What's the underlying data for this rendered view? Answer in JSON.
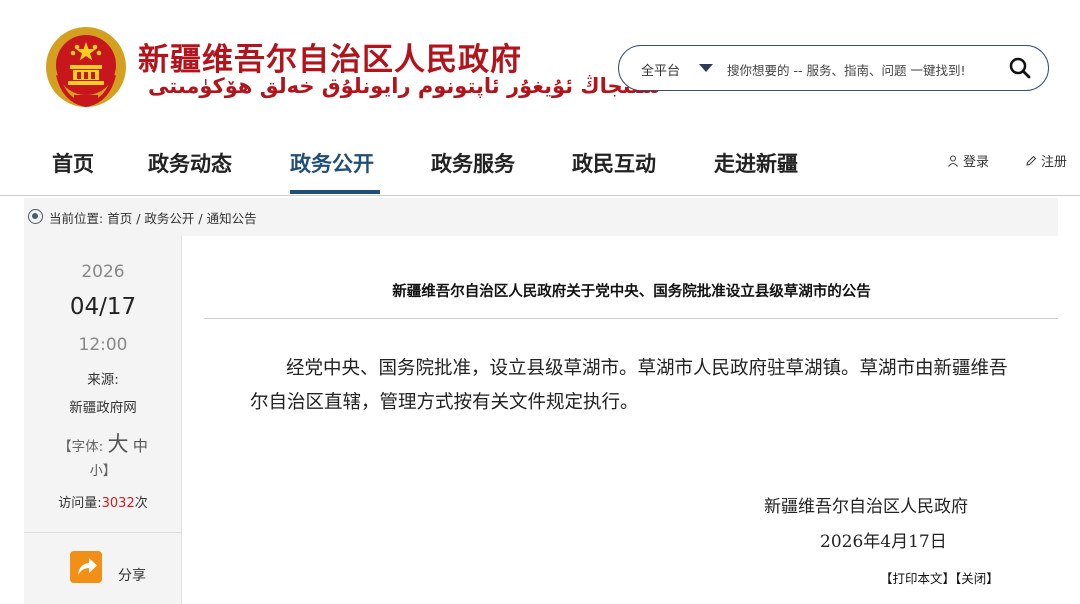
{
  "header": {
    "title": "新疆维吾尔自治区人民政府",
    "subtitle": "شىنجاڭ ئۇيغۇر ئاپتونوم رايونلۇق خەلق ھۆكۈمىتى",
    "colors": {
      "brand_red": "#b3141b",
      "nav_blue": "#1f4e79"
    }
  },
  "search": {
    "scope": "全平台",
    "placeholder": "搜你想要的 -- 服务、指南、问题  一键找到!",
    "icon": "search-icon"
  },
  "nav": {
    "items": [
      {
        "label": "首页"
      },
      {
        "label": "政务动态"
      },
      {
        "label": "政务公开",
        "active": true
      },
      {
        "label": "政务服务"
      },
      {
        "label": "政民互动"
      },
      {
        "label": "走进新疆"
      }
    ],
    "login": "登录",
    "register": "注册"
  },
  "breadcrumb": {
    "label": "当前位置:",
    "items": [
      "首页",
      "政务公开",
      "通知公告"
    ],
    "separator": " / "
  },
  "sidebar": {
    "year": "2026",
    "date": "04/17",
    "time": "12:00",
    "source_label": "来源:",
    "source": "新疆政府网",
    "font_label": "【字体:",
    "font_large": "大",
    "font_medium": "中",
    "font_small": "小",
    "font_close": "】",
    "visits_label": "访问量:",
    "visits": "3032",
    "visits_unit": "次",
    "share": "分享"
  },
  "article": {
    "title": "新疆维吾尔自治区人民政府关于党中央、国务院批准设立县级草湖市的公告",
    "body": "经党中央、国务院批准，设立县级草湖市。草湖市人民政府驻草湖镇。草湖市由新疆维吾尔自治区直辖，管理方式按有关文件规定执行。",
    "signature_org": "新疆维吾尔自治区人民政府",
    "signature_date": "2026年4月17日",
    "print": "【打印本文】",
    "close": "【关闭】"
  }
}
